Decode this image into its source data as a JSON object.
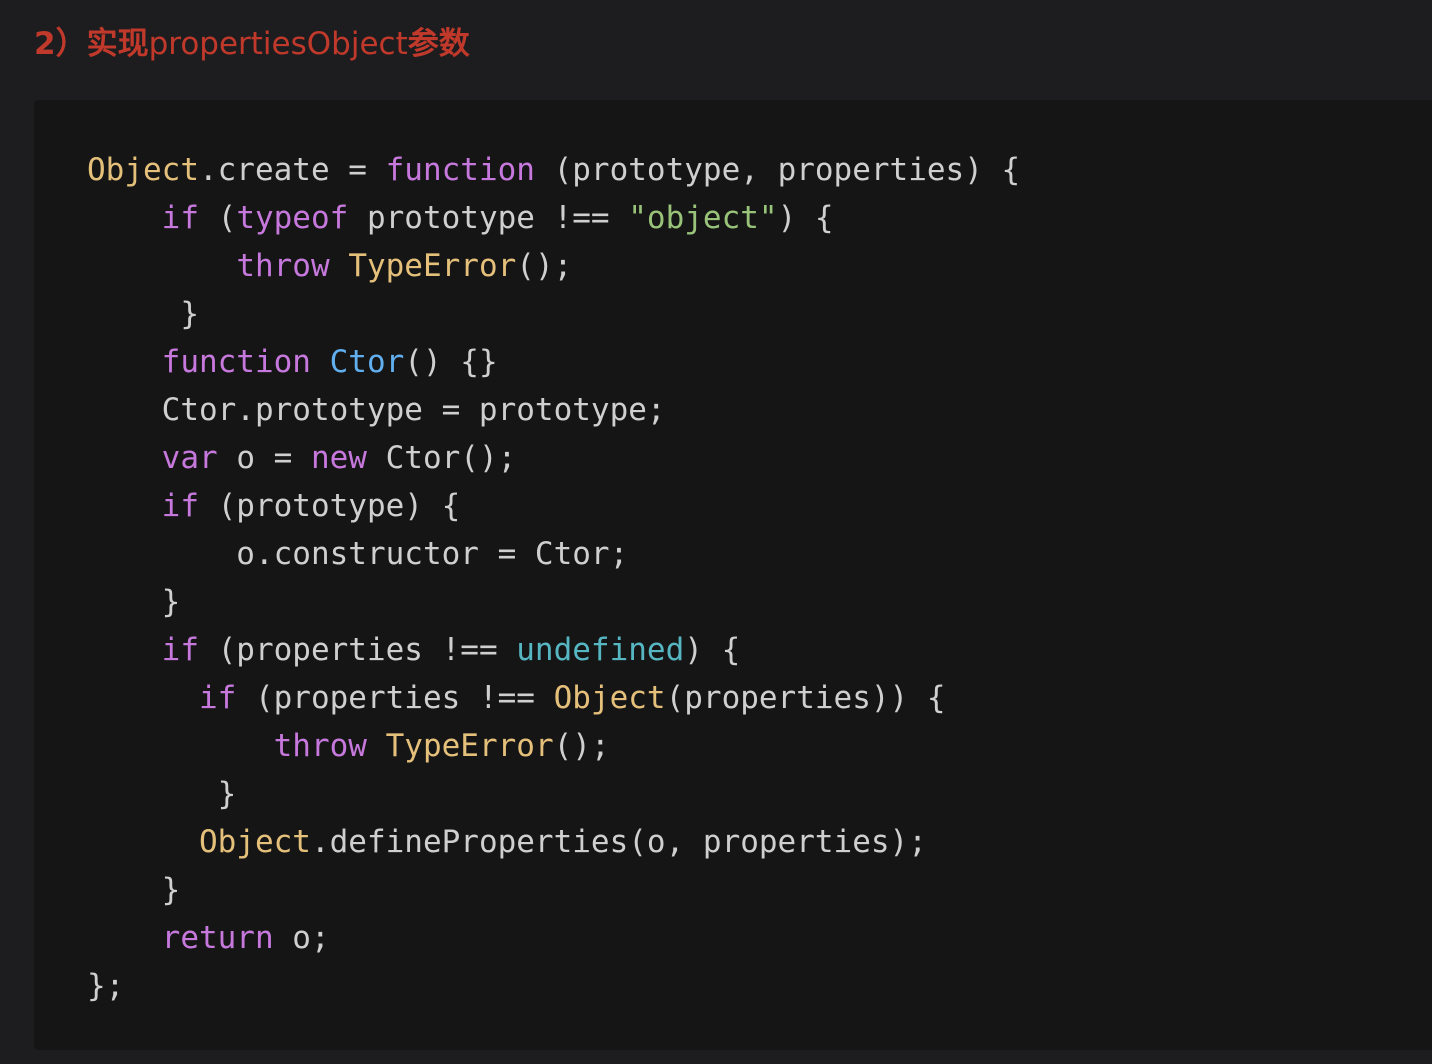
{
  "heading": {
    "number": "2）",
    "cjk_prefix": "实现",
    "word": "propertiesObject",
    "cjk_suffix": "参数"
  },
  "theme": {
    "background": "#1d1d1f",
    "code_background": "#151515",
    "heading_color": "#c0392b",
    "keyword": "#c678dd",
    "class_name": "#e5c07b",
    "function_name": "#61afef",
    "string": "#98c379",
    "literal": "#56b6c2",
    "plain": "#cfcfcf"
  },
  "code_lines": [
    [
      {
        "t": "cls",
        "v": "Object"
      },
      {
        "t": "pl",
        "v": ".create = "
      },
      {
        "t": "kw",
        "v": "function"
      },
      {
        "t": "pl",
        "v": " (prototype, properties) {"
      }
    ],
    [
      {
        "t": "pl",
        "v": "    "
      },
      {
        "t": "kw",
        "v": "if"
      },
      {
        "t": "pl",
        "v": " ("
      },
      {
        "t": "kw",
        "v": "typeof"
      },
      {
        "t": "pl",
        "v": " prototype !== "
      },
      {
        "t": "str",
        "v": "\"object\""
      },
      {
        "t": "pl",
        "v": ") {"
      }
    ],
    [
      {
        "t": "pl",
        "v": "        "
      },
      {
        "t": "kw",
        "v": "throw"
      },
      {
        "t": "pl",
        "v": " "
      },
      {
        "t": "cls",
        "v": "TypeError"
      },
      {
        "t": "pl",
        "v": "();"
      }
    ],
    [
      {
        "t": "pl",
        "v": "     }"
      }
    ],
    [
      {
        "t": "pl",
        "v": "    "
      },
      {
        "t": "kw",
        "v": "function"
      },
      {
        "t": "pl",
        "v": " "
      },
      {
        "t": "fn",
        "v": "Ctor"
      },
      {
        "t": "pl",
        "v": "() {}"
      }
    ],
    [
      {
        "t": "pl",
        "v": "    Ctor.prototype = prototype;"
      }
    ],
    [
      {
        "t": "pl",
        "v": "    "
      },
      {
        "t": "kw",
        "v": "var"
      },
      {
        "t": "pl",
        "v": " o = "
      },
      {
        "t": "kw",
        "v": "new"
      },
      {
        "t": "pl",
        "v": " Ctor();"
      }
    ],
    [
      {
        "t": "pl",
        "v": "    "
      },
      {
        "t": "kw",
        "v": "if"
      },
      {
        "t": "pl",
        "v": " (prototype) {"
      }
    ],
    [
      {
        "t": "pl",
        "v": "        o.constructor = Ctor;"
      }
    ],
    [
      {
        "t": "pl",
        "v": "    }"
      }
    ],
    [
      {
        "t": "pl",
        "v": "    "
      },
      {
        "t": "kw",
        "v": "if"
      },
      {
        "t": "pl",
        "v": " (properties !== "
      },
      {
        "t": "lit",
        "v": "undefined"
      },
      {
        "t": "pl",
        "v": ") {"
      }
    ],
    [
      {
        "t": "pl",
        "v": "      "
      },
      {
        "t": "kw",
        "v": "if"
      },
      {
        "t": "pl",
        "v": " (properties !== "
      },
      {
        "t": "cls",
        "v": "Object"
      },
      {
        "t": "pl",
        "v": "(properties)) {"
      }
    ],
    [
      {
        "t": "pl",
        "v": "          "
      },
      {
        "t": "kw",
        "v": "throw"
      },
      {
        "t": "pl",
        "v": " "
      },
      {
        "t": "cls",
        "v": "TypeError"
      },
      {
        "t": "pl",
        "v": "();"
      }
    ],
    [
      {
        "t": "pl",
        "v": "       }"
      }
    ],
    [
      {
        "t": "pl",
        "v": "      "
      },
      {
        "t": "cls",
        "v": "Object"
      },
      {
        "t": "pl",
        "v": ".defineProperties(o, properties);"
      }
    ],
    [
      {
        "t": "pl",
        "v": "    }"
      }
    ],
    [
      {
        "t": "pl",
        "v": "    "
      },
      {
        "t": "kw",
        "v": "return"
      },
      {
        "t": "pl",
        "v": " o;"
      }
    ],
    [
      {
        "t": "pl",
        "v": "};"
      }
    ]
  ]
}
